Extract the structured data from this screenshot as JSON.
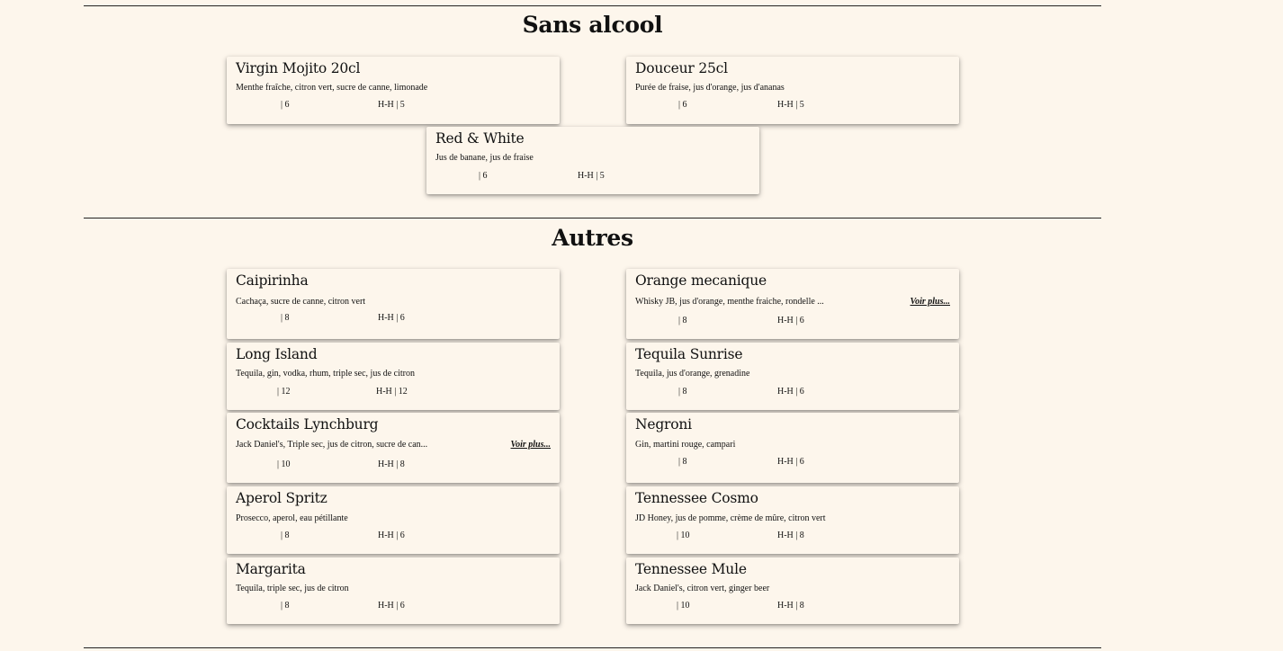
{
  "sections": [
    {
      "title": "Sans alcool",
      "items": [
        {
          "name": "Virgin Mojito 20cl",
          "desc": "Menthe fraîche, citron vert, sucre de canne, limonade",
          "price": "| 6",
          "happy": "H-H | 5"
        },
        {
          "name": "Douceur 25cl",
          "desc": "Purée de fraise, jus d'orange, jus d'ananas",
          "price": "| 6",
          "happy": "H-H | 5"
        },
        {
          "name": "Red & White",
          "desc": "Jus de banane, jus de fraise",
          "price": "| 6",
          "happy": "H-H | 5"
        }
      ]
    },
    {
      "title": "Autres",
      "items": [
        {
          "name": "Caipirinha",
          "desc": "Cachaça, sucre de canne, citron vert",
          "price": "| 8",
          "happy": "H-H | 6"
        },
        {
          "name": "Orange mecanique",
          "desc": "Whisky JB, jus d'orange, menthe fraiche, rondelle ...",
          "more": "Voir plus...",
          "price": "| 8",
          "happy": "H-H | 6"
        },
        {
          "name": "Long Island",
          "desc": "Tequila, gin, vodka, rhum, triple sec, jus de citron",
          "price": "| 12",
          "happy": "H-H | 12"
        },
        {
          "name": "Tequila Sunrise",
          "desc": "Tequila, jus d'orange, grenadine",
          "price": "| 8",
          "happy": "H-H | 6"
        },
        {
          "name": "Cocktails Lynchburg",
          "desc": "Jack Daniel's, Triple sec, jus de citron, sucre de can...",
          "more": "Voir plus...",
          "price": "| 10",
          "happy": "H-H | 8"
        },
        {
          "name": "Negroni",
          "desc": "Gin, martini rouge, campari",
          "price": "| 8",
          "happy": "H-H | 6"
        },
        {
          "name": "Aperol Spritz",
          "desc": "Prosecco, aperol, eau pétillante",
          "price": "| 8",
          "happy": "H-H | 6"
        },
        {
          "name": "Tennessee Cosmo",
          "desc": "JD Honey, jus de pomme, crème de mûre, citron vert",
          "price": "| 10",
          "happy": "H-H | 8"
        },
        {
          "name": "Margarita",
          "desc": "Tequila, triple sec, jus de citron",
          "price": "| 8",
          "happy": "H-H | 6"
        },
        {
          "name": "Tennessee Mule",
          "desc": "Jack Daniel's, citron vert, ginger beer",
          "price": "| 10",
          "happy": "H-H | 8"
        }
      ]
    }
  ]
}
